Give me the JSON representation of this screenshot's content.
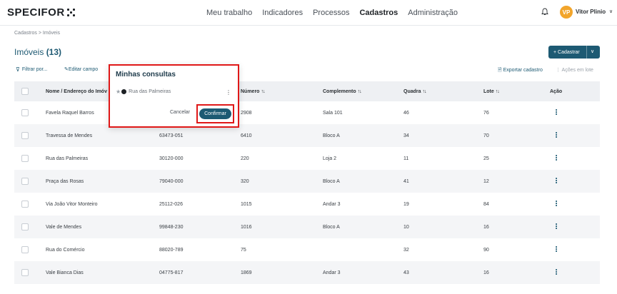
{
  "app": {
    "logo": "SPECIFOR"
  },
  "nav": [
    "Meu trabalho",
    "Indicadores",
    "Processos",
    "Cadastros",
    "Administração"
  ],
  "nav_active": "Cadastros",
  "user": {
    "initials": "VP",
    "name": "Vitor Plinio",
    "avatar_color": "#f2a52b"
  },
  "breadcrumb": "Cadastros > Imóveis",
  "page": {
    "title": "Imóveis",
    "count": "(13)"
  },
  "actions": {
    "cadastrar": "+ Cadastrar",
    "cadastrar_chevron": "∨",
    "filter": "Filtrar por...",
    "edit": "Editar campo",
    "export": "Exportar cadastro",
    "batch": "⋮ Ações em lote"
  },
  "table": {
    "headers": [
      "Nome / Endereço do Imóv",
      "Número",
      "Complemento",
      "Quadra",
      "Lote",
      "Ação"
    ],
    "rows": [
      [
        "Favela Raquel Barros",
        "",
        "2908",
        "Sala 101",
        "46",
        "76"
      ],
      [
        "Travessa de Mendes",
        "63473-051",
        "6410",
        "Bloco A",
        "34",
        "70"
      ],
      [
        "Rua das Palmeiras",
        "30120-000",
        "220",
        "Loja 2",
        "11",
        "25"
      ],
      [
        "Praça das Rosas",
        "79040-000",
        "320",
        "Bloco A",
        "41",
        "12"
      ],
      [
        "Via João Vitor Monteiro",
        "25112-026",
        "1015",
        "Andar 3",
        "19",
        "84"
      ],
      [
        "Vale de Mendes",
        "99848-230",
        "1016",
        "Bloco A",
        "10",
        "16"
      ],
      [
        "Rua do Comércio",
        "88020-789",
        "75",
        "",
        "32",
        "90"
      ],
      [
        "Vale Bianca Dias",
        "04775-817",
        "1869",
        "Andar 3",
        "43",
        "16"
      ]
    ]
  },
  "popover": {
    "title": "Minhas consultas",
    "item": "Rua das Palmeiras",
    "cancel": "Cancelar",
    "confirm": "Confirmar"
  },
  "colors": {
    "primary": "#1d5a73",
    "highlight": "#e01818"
  }
}
